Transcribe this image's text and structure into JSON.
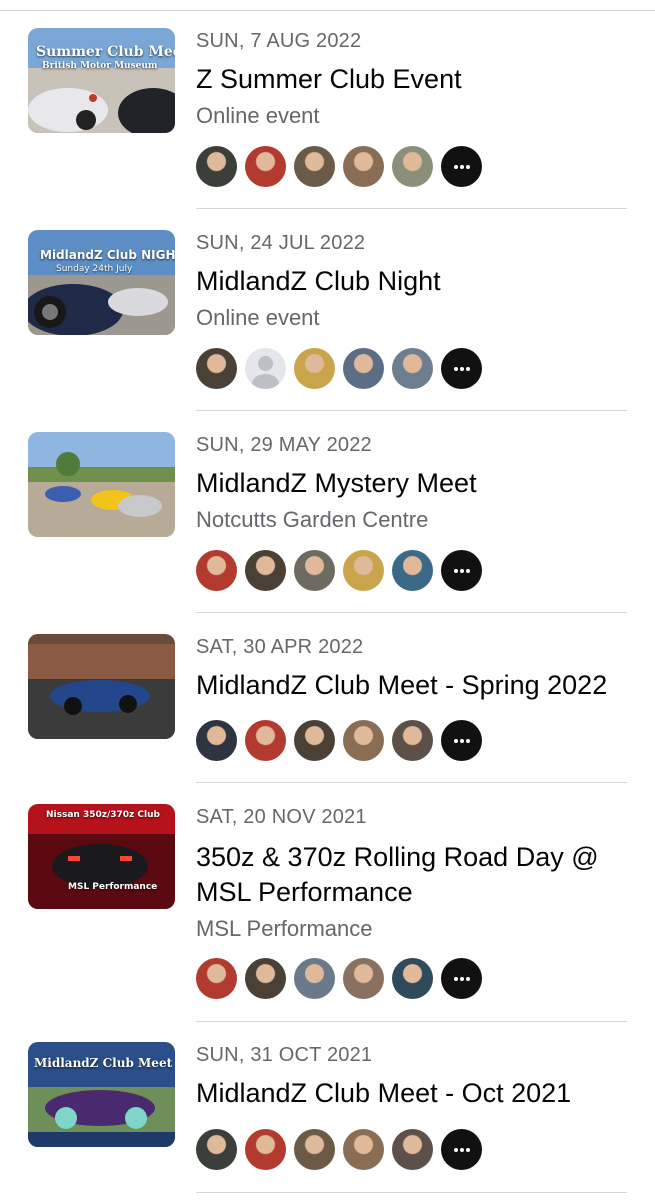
{
  "events": [
    {
      "date": "SUN, 7 AUG 2022",
      "title": "Z Summer Club Event",
      "location": "Online event",
      "thumb_text": "Summer Club Meet",
      "thumb_subtext": "British Motor Museum",
      "avatar_colors": [
        "#3a3f3a",
        "#b23a2f",
        "#6b5a48",
        "#8a6d55",
        "#8a8f7a",
        "more"
      ]
    },
    {
      "date": "SUN, 24 JUL 2022",
      "title": "MidlandZ Club Night",
      "location": "Online event",
      "thumb_text": "MidlandZ Club NIGHT",
      "thumb_subtext": "Sunday 24th July",
      "avatar_colors": [
        "#4a4036",
        "placeholder",
        "#c9a44a",
        "#5c6e86",
        "#6d7e8e",
        "more"
      ]
    },
    {
      "date": "SUN, 29 MAY 2022",
      "title": "MidlandZ Mystery Meet",
      "location": "Notcutts Garden Centre",
      "thumb_text": "",
      "thumb_subtext": "",
      "avatar_colors": [
        "#b23a2f",
        "#4a4036",
        "#6d6a62",
        "#c9a44a",
        "#3b6a86",
        "more"
      ]
    },
    {
      "date": "SAT, 30 APR 2022",
      "title": "MidlandZ Club Meet - Spring 2022",
      "location": "",
      "thumb_text": "",
      "thumb_subtext": "",
      "avatar_colors": [
        "#2e3440",
        "#b23a2f",
        "#4a4036",
        "#8a6d55",
        "#5c5048",
        "more"
      ]
    },
    {
      "date": "SAT, 20 NOV 2021",
      "title": "350z & 370z Rolling Road Day @ MSL Performance",
      "location": "MSL Performance",
      "thumb_text": "Nissan 350z/370z Club",
      "thumb_subtext": "MSL Performance",
      "avatar_colors": [
        "#b23a2f",
        "#4a4036",
        "#6a7a8a",
        "#8a7060",
        "#2f4a5a",
        "more"
      ]
    },
    {
      "date": "SUN, 31 OCT 2021",
      "title": "MidlandZ Club Meet - Oct 2021",
      "location": "",
      "thumb_text": "MidlandZ Club Meet",
      "thumb_subtext": "",
      "avatar_colors": [
        "#3a3f3a",
        "#b23a2f",
        "#6b5a48",
        "#8a6d55",
        "#5c5048",
        "more"
      ]
    }
  ]
}
